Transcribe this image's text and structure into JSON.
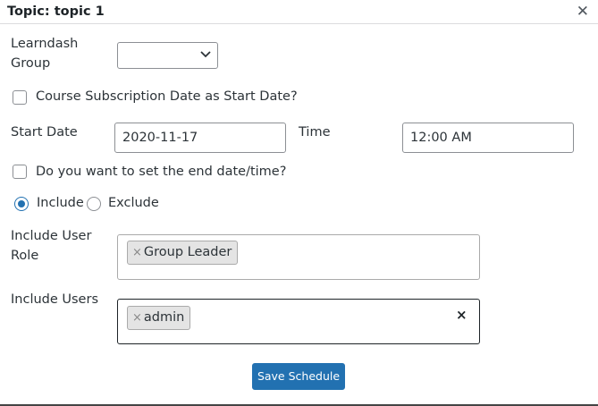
{
  "dialog": {
    "title": "Topic: topic 1",
    "close_glyph": "✕"
  },
  "form": {
    "group_label_line1": "Learndash",
    "group_label_line2": "Group",
    "group_value": "",
    "subscription_checkbox_label": "Course Subscription Date as Start Date?",
    "subscription_checked": false,
    "start_date_label": "Start Date",
    "start_date_value": "2020-11-17",
    "time_label": "Time",
    "time_value": "12:00 AM",
    "end_date_checkbox_label": "Do you want to set the end date/time?",
    "end_date_checked": false,
    "include_label": "Include",
    "exclude_label": "Exclude",
    "selected_mode": "Include",
    "user_role_label_line1": "Include User",
    "user_role_label_line2": "Role",
    "user_role_tags": [
      "Group Leader"
    ],
    "users_label": "Include Users",
    "users_tags": [
      "admin"
    ],
    "tag_remove_glyph": "×",
    "clear_glyph": "×",
    "save_label": "Save Schedule"
  },
  "colors": {
    "accent": "#2271b1",
    "tag_bg": "#e4e4e4",
    "border": "#8c8f94"
  }
}
